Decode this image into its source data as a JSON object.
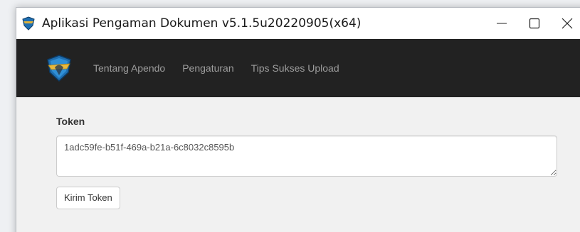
{
  "window": {
    "title": "Aplikasi Pengaman Dokumen v5.1.5u20220905(x64)"
  },
  "navbar": {
    "items": [
      {
        "label": "Tentang Apendo"
      },
      {
        "label": "Pengaturan"
      },
      {
        "label": "Tips Sukses Upload"
      }
    ]
  },
  "form": {
    "token_label": "Token",
    "token_value": "1adc59fe-b51f-469a-b21a-6c8032c8595b",
    "submit_label": "Kirim Token"
  },
  "colors": {
    "navbar_bg": "#222222",
    "nav_text": "#9d9d9d",
    "content_bg": "#f1f1f1"
  },
  "icons": {
    "app": "shield-icon",
    "brand": "shield-logo-icon",
    "minimize": "minimize-icon",
    "maximize": "maximize-icon",
    "close": "close-icon"
  }
}
